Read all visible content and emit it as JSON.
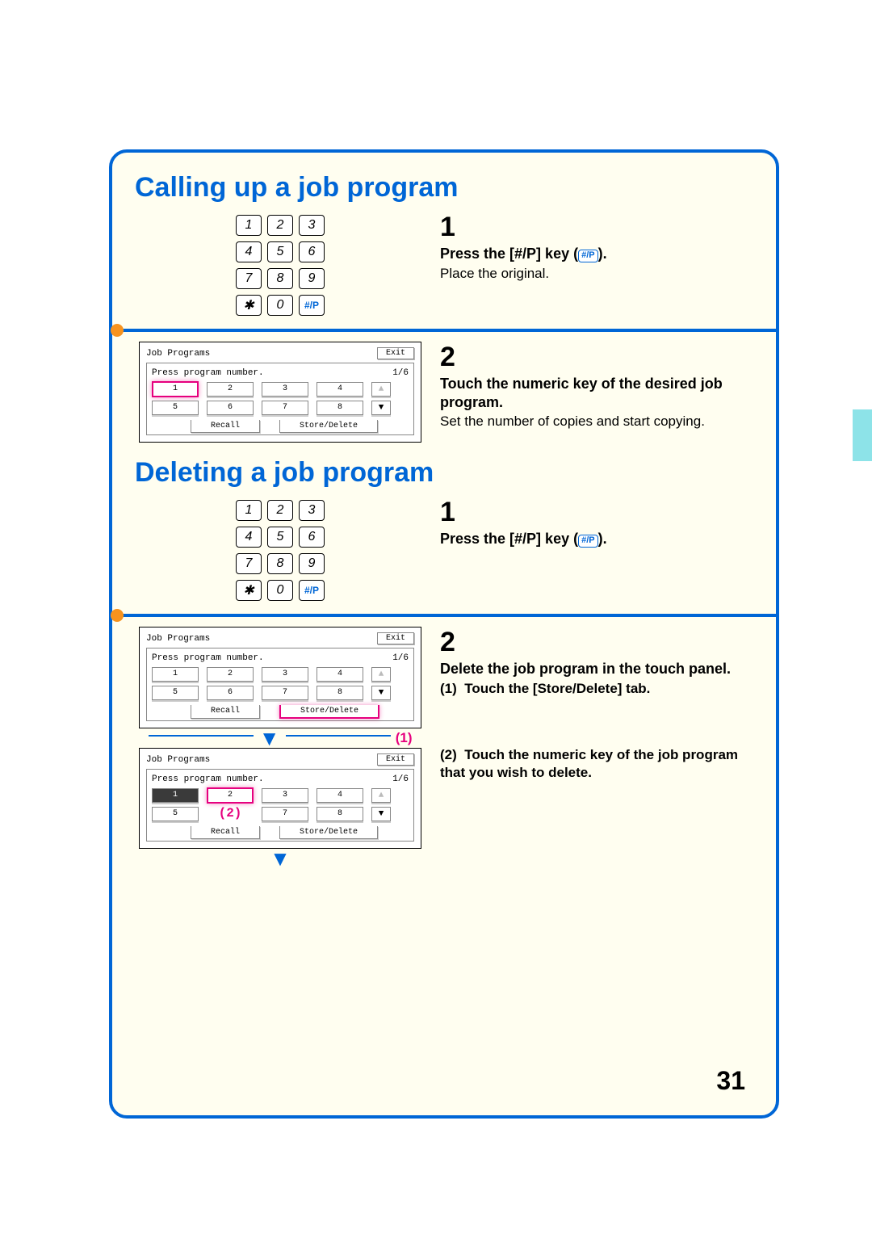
{
  "page_number": "31",
  "section1": {
    "heading": "Calling up a job program",
    "step1": {
      "num": "1",
      "bold_pre": "Press the [#/P] key (",
      "bold_post": ").",
      "text": "Place the original."
    },
    "step2": {
      "num": "2",
      "bold": "Touch the numeric key of the desired job program.",
      "text": "Set the number of copies and start copying."
    }
  },
  "section2": {
    "heading": "Deleting a job program",
    "step1": {
      "num": "1",
      "bold_pre": "Press the [#/P] key (",
      "bold_post": ")."
    },
    "step2": {
      "num": "2",
      "bold": "Delete the job program in the touch panel.",
      "sub1_n": "(1)",
      "sub1": "Touch the [Store/Delete] tab.",
      "sub2_n": "(2)",
      "sub2": "Touch the numeric key of the job program that you wish to delete."
    }
  },
  "keypad": [
    "1",
    "2",
    "3",
    "4",
    "5",
    "6",
    "7",
    "8",
    "9",
    "✱",
    "0",
    "#/P"
  ],
  "panel": {
    "title": "Job Programs",
    "exit": "Exit",
    "prompt": "Press program number.",
    "pager": "1/6",
    "nums": [
      "1",
      "2",
      "3",
      "4",
      "5",
      "6",
      "7",
      "8"
    ],
    "recall": "Recall",
    "store": "Store/Delete"
  },
  "flow": {
    "n1": "(1)",
    "n2": "(2)"
  },
  "hp_badge": "#/P"
}
